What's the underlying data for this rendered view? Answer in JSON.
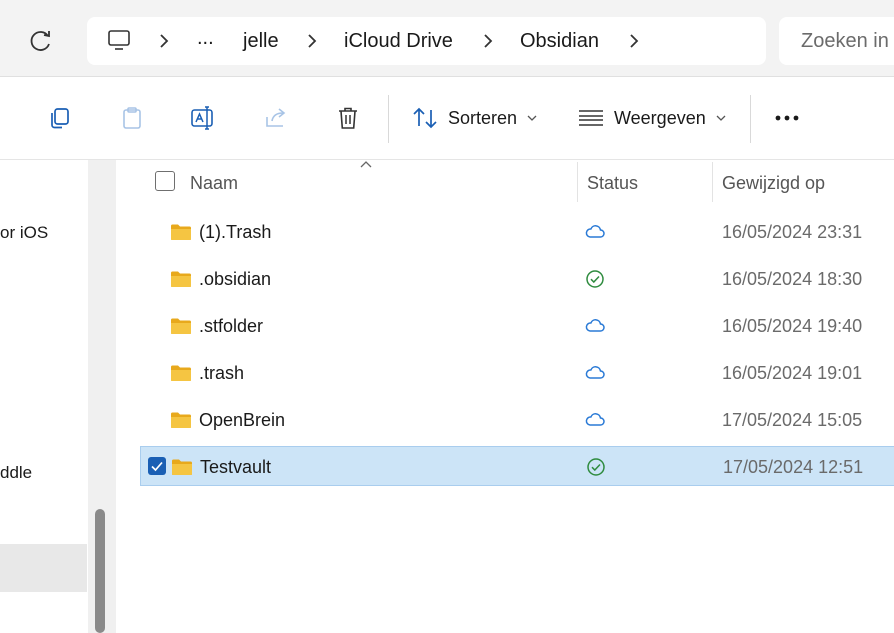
{
  "breadcrumb": {
    "overflow": "...",
    "items": [
      "jelle",
      "iCloud Drive",
      "Obsidian"
    ]
  },
  "search": {
    "placeholder": "Zoeken in"
  },
  "toolbar": {
    "sort_label": "Sorteren",
    "view_label": "Weergeven",
    "more_label": "..."
  },
  "sidebar": {
    "items": [
      "or iOS",
      "ddle"
    ]
  },
  "columns": {
    "name": "Naam",
    "status": "Status",
    "modified": "Gewijzigd op"
  },
  "files": [
    {
      "name": "(1).Trash",
      "status": "cloud",
      "modified": "16/05/2024 23:31",
      "selected": false
    },
    {
      "name": ".obsidian",
      "status": "synced",
      "modified": "16/05/2024 18:30",
      "selected": false
    },
    {
      "name": ".stfolder",
      "status": "cloud",
      "modified": "16/05/2024 19:40",
      "selected": false
    },
    {
      "name": ".trash",
      "status": "cloud",
      "modified": "16/05/2024 19:01",
      "selected": false
    },
    {
      "name": "OpenBrein",
      "status": "cloud",
      "modified": "17/05/2024 15:05",
      "selected": false
    },
    {
      "name": "Testvault",
      "status": "synced",
      "modified": "17/05/2024 12:51",
      "selected": true
    }
  ],
  "colors": {
    "accent": "#1a5fb4",
    "selection": "#cce4f7",
    "cloud": "#2a7ad6",
    "synced": "#2e8b3e",
    "folder": "#f5c542"
  }
}
